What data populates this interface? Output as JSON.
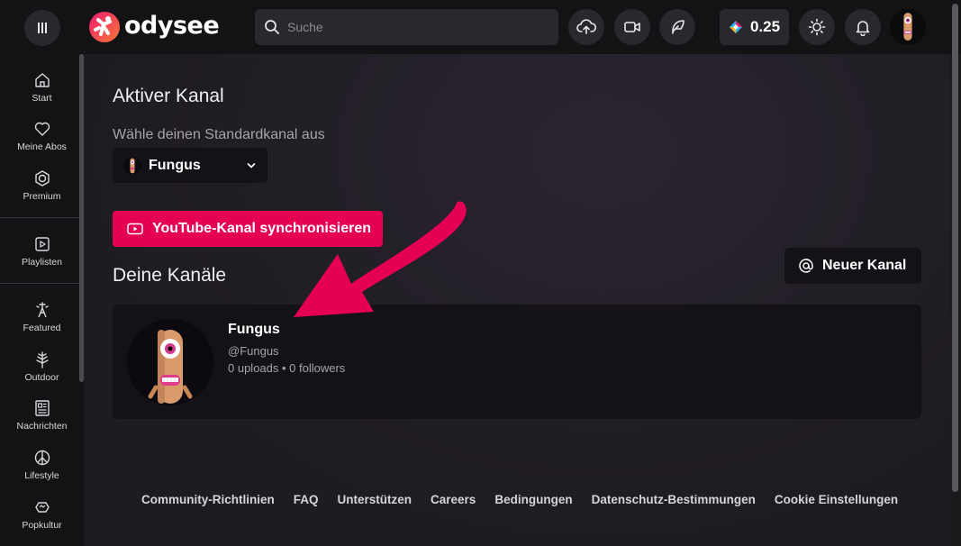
{
  "header": {
    "logo_text": "odysee",
    "search_placeholder": "Suche",
    "credits": "0.25",
    "icons": [
      "menu-icon",
      "upload-icon",
      "video-camera-icon",
      "feather-icon",
      "credits-icon",
      "sun-icon",
      "bell-icon"
    ]
  },
  "sidebar": {
    "items": [
      {
        "label": "Start",
        "icon": "home-icon"
      },
      {
        "label": "Meine Abos",
        "icon": "heart-icon"
      },
      {
        "label": "Premium",
        "icon": "premium-icon"
      },
      {
        "label": "Playlisten",
        "icon": "playlist-icon"
      },
      {
        "label": "Featured",
        "icon": "featured-icon"
      },
      {
        "label": "Outdoor",
        "icon": "tree-icon"
      },
      {
        "label": "Nachrichten",
        "icon": "newspaper-icon"
      },
      {
        "label": "Lifestyle",
        "icon": "peace-icon"
      },
      {
        "label": "Popkultur",
        "icon": "popculture-icon"
      }
    ]
  },
  "main": {
    "active_channel_title": "Aktiver Kanal",
    "choose_default_label": "Wähle deinen Standardkanal aus",
    "selected_channel": "Fungus",
    "youtube_sync_label": "YouTube-Kanal synchronisieren",
    "your_channels_title": "Deine Kanäle",
    "new_channel_label": "Neuer Kanal",
    "channels": [
      {
        "name": "Fungus",
        "handle": "@Fungus",
        "stats": "0 uploads • 0 followers"
      }
    ]
  },
  "footer": {
    "links": [
      "Community-Richtlinien",
      "FAQ",
      "Unterstützen",
      "Careers",
      "Bedingungen",
      "Datenschutz-Bestimmungen",
      "Cookie Einstellungen"
    ]
  },
  "colors": {
    "accent": "#e50054",
    "background": "#1f1c22",
    "header": "#131214"
  }
}
